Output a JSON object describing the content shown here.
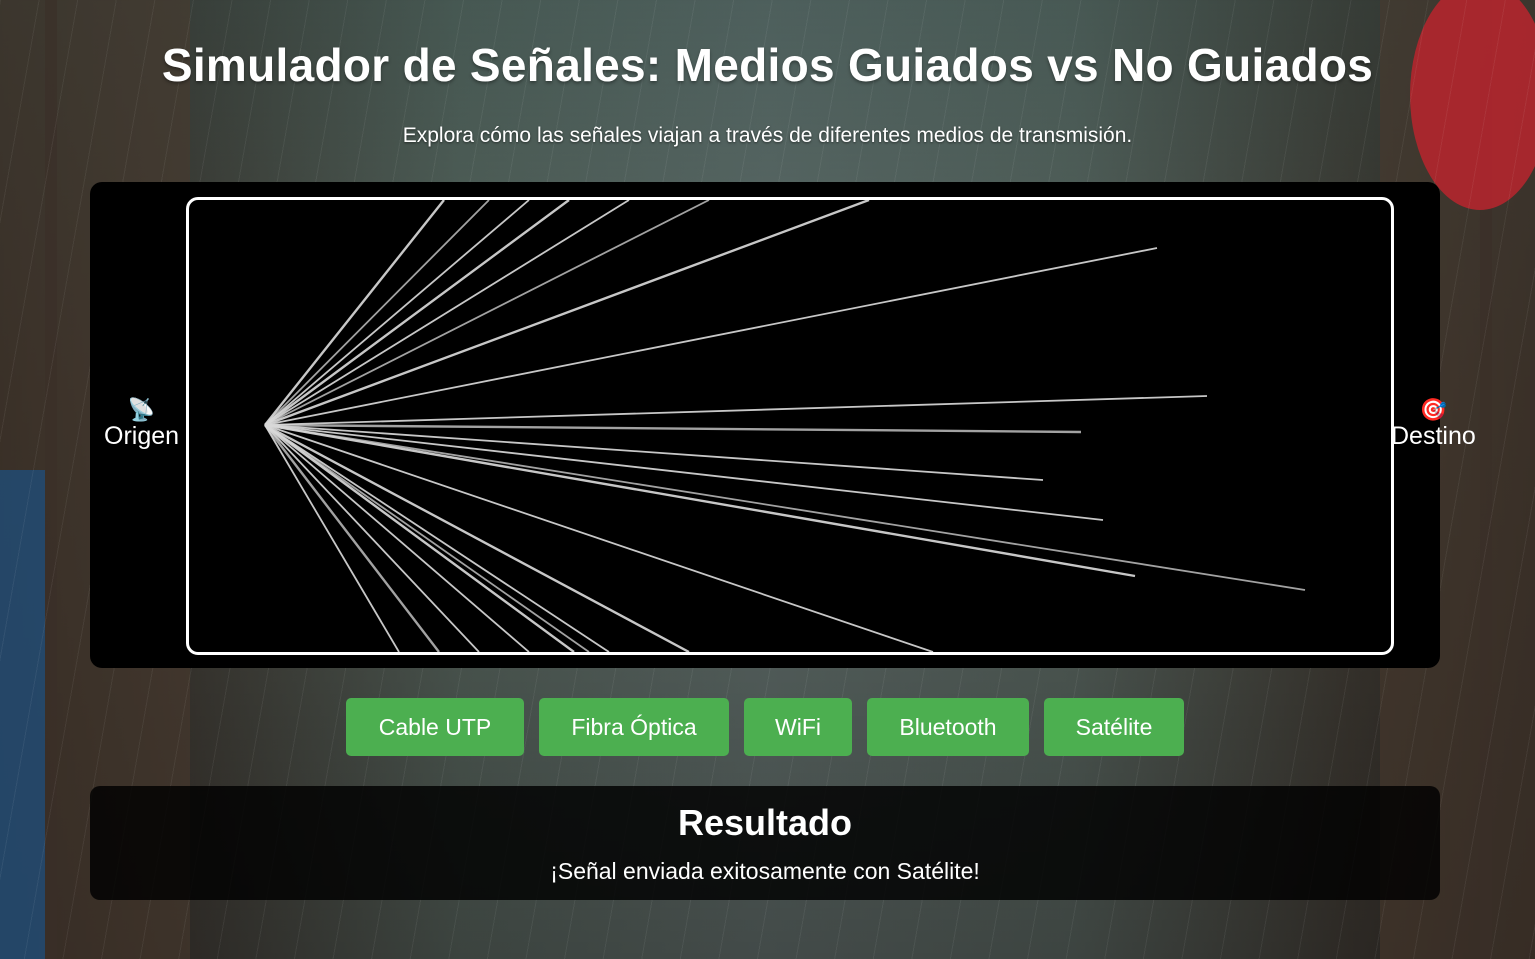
{
  "header": {
    "title": "Simulador de Señales: Medios Guiados vs No Guiados",
    "subtitle": "Explora cómo las señales viajan a través de diferentes medios de transmisión."
  },
  "simulation": {
    "origin": {
      "icon": "satellite-antenna-icon",
      "label": "Origen"
    },
    "destination": {
      "icon": "target-icon",
      "label": "Destino"
    },
    "signal_color": "#d8d8d8"
  },
  "media_buttons": [
    {
      "label": "Cable UTP"
    },
    {
      "label": "Fibra Óptica"
    },
    {
      "label": "WiFi"
    },
    {
      "label": "Bluetooth"
    },
    {
      "label": "Satélite"
    }
  ],
  "result": {
    "title": "Resultado",
    "message": "¡Señal enviada exitosamente con Satélite!"
  },
  "colors": {
    "button": "#4caf50",
    "panel": "#000000"
  }
}
